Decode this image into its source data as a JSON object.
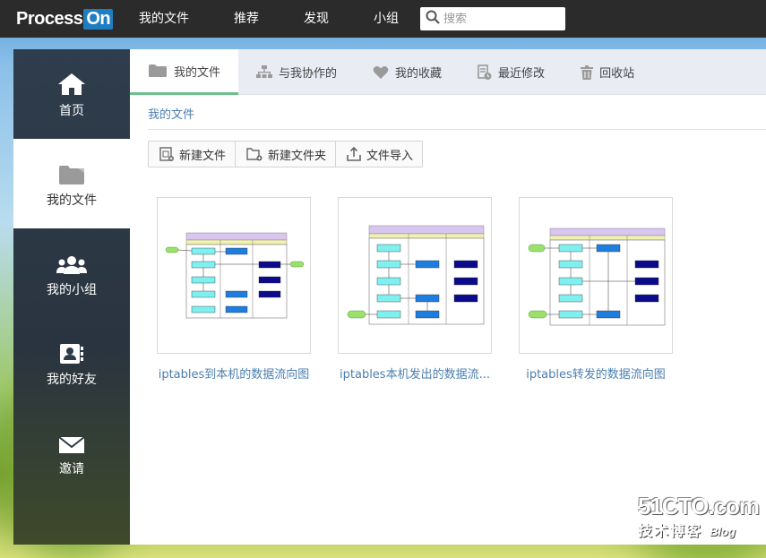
{
  "app": {
    "logo_text": "Process",
    "logo_badge": "On",
    "accent": "#1f7ec2"
  },
  "topnav": {
    "items": [
      {
        "label": "我的文件"
      },
      {
        "label": "推荐"
      },
      {
        "label": "发现"
      },
      {
        "label": "小组"
      }
    ],
    "search_placeholder": "搜索",
    "search_icon": "search-icon"
  },
  "sidebar": {
    "items": [
      {
        "label": "首页",
        "icon": "home-icon",
        "active": false
      },
      {
        "label": "我的文件",
        "icon": "folder-icon",
        "active": true
      },
      {
        "label": "我的小组",
        "icon": "group-icon",
        "active": false
      },
      {
        "label": "我的好友",
        "icon": "contacts-icon",
        "active": false
      },
      {
        "label": "邀请",
        "icon": "mail-icon",
        "active": false
      }
    ]
  },
  "tabs": [
    {
      "label": "我的文件",
      "icon": "folder-icon",
      "active": true
    },
    {
      "label": "与我协作的",
      "icon": "org-chart-icon",
      "active": false
    },
    {
      "label": "我的收藏",
      "icon": "heart-icon",
      "active": false
    },
    {
      "label": "最近修改",
      "icon": "document-clock-icon",
      "active": false
    },
    {
      "label": "回收站",
      "icon": "trash-icon",
      "active": false
    }
  ],
  "breadcrumb": "我的文件",
  "toolbar": {
    "new_file": "新建文件",
    "new_folder": "新建文件夹",
    "import": "文件导入"
  },
  "files": [
    {
      "name": "iptables到本机的数据流向图"
    },
    {
      "name": "iptables本机发出的数据流..."
    },
    {
      "name": "iptables转发的数据流向图"
    }
  ],
  "watermark": {
    "site": "51CTO.com",
    "sub": "技术博客",
    "blog": "Blog"
  }
}
